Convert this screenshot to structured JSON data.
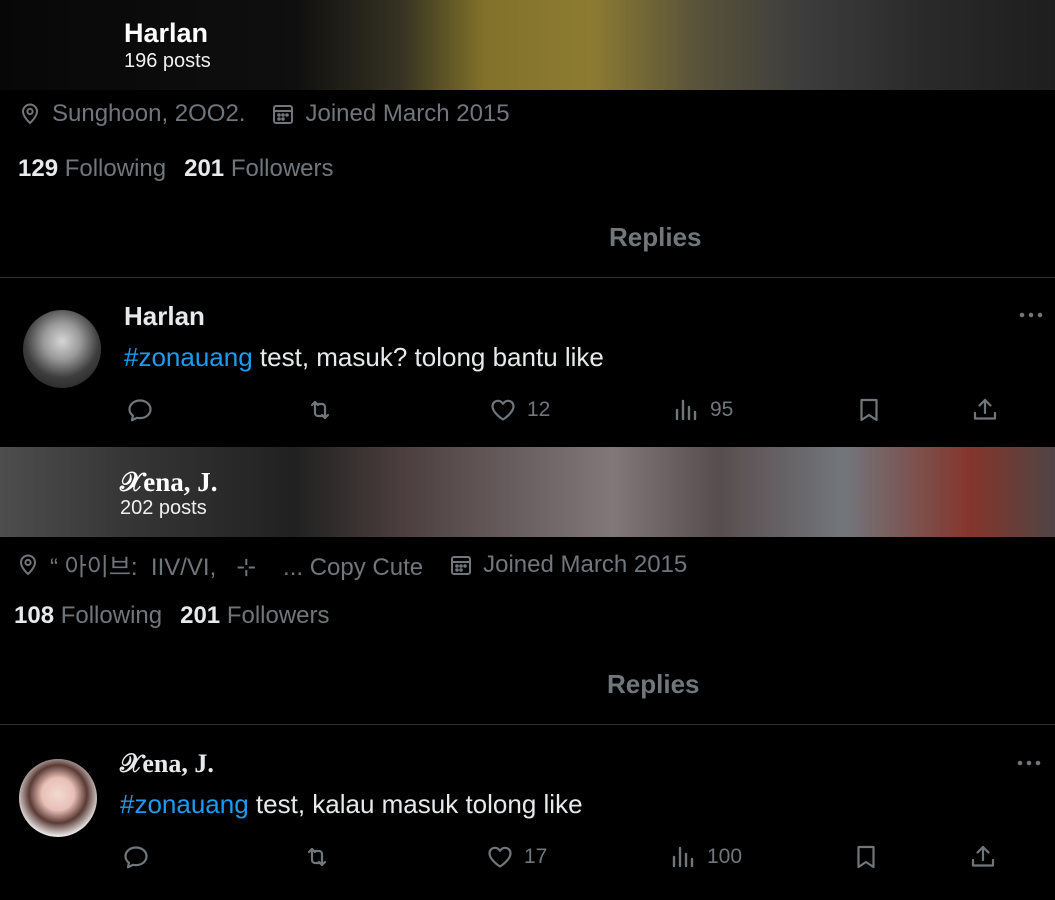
{
  "profiles": [
    {
      "header": {
        "name": "Harlan",
        "posts": "196 posts"
      },
      "meta": {
        "location": "Sunghoon, 2OO2.",
        "joined": "Joined March 2015"
      },
      "stats": {
        "following_count": "129",
        "following_label": "Following",
        "followers_count": "201",
        "followers_label": "Followers"
      },
      "tab": "Replies",
      "tweet": {
        "author": "Harlan",
        "hashtag": "#zonauang",
        "text": " test, masuk? tolong bantu like",
        "likes": "12",
        "views": "95"
      }
    },
    {
      "header": {
        "name": "𝒳ena, J.",
        "posts": "202 posts"
      },
      "meta": {
        "location": "“ 아이브:  IIV/VI,   ⊹    ... Copy Cute",
        "joined": "Joined March 2015"
      },
      "stats": {
        "following_count": "108",
        "following_label": "Following",
        "followers_count": "201",
        "followers_label": "Followers"
      },
      "tab": "Replies",
      "tweet": {
        "author": "𝒳ena, J.",
        "hashtag": "#zonauang",
        "text": " test, kalau masuk tolong like",
        "likes": "17",
        "views": "100"
      }
    }
  ],
  "icons": {
    "location": "location-pin-icon",
    "calendar": "calendar-icon",
    "reply": "reply-icon",
    "retweet": "retweet-icon",
    "like": "heart-icon",
    "views": "views-icon",
    "bookmark": "bookmark-icon",
    "share": "share-icon",
    "more": "more-icon"
  },
  "colors": {
    "background": "#000000",
    "link": "#1d9bf0",
    "muted": "#71767b",
    "text": "#e7e9ea",
    "divider": "#2f3336"
  }
}
